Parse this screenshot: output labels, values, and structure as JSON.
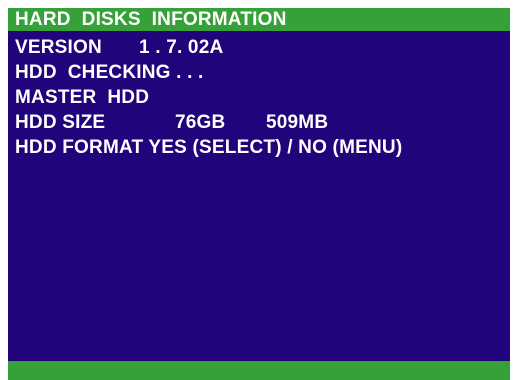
{
  "title": "HARD  DISKS  INFORMATION",
  "version": {
    "label": "VERSION",
    "value": "1 . 7. 02A"
  },
  "status": "HDD  CHECKING . . .",
  "disk": "MASTER  HDD",
  "size": {
    "label": "HDD SIZE",
    "gb": "76GB",
    "mb": "509MB"
  },
  "format_prompt": "HDD FORMAT YES (SELECT) / NO (MENU)",
  "colors": {
    "background": "#21037c",
    "bar": "#37a139",
    "text": "#ffffff"
  }
}
